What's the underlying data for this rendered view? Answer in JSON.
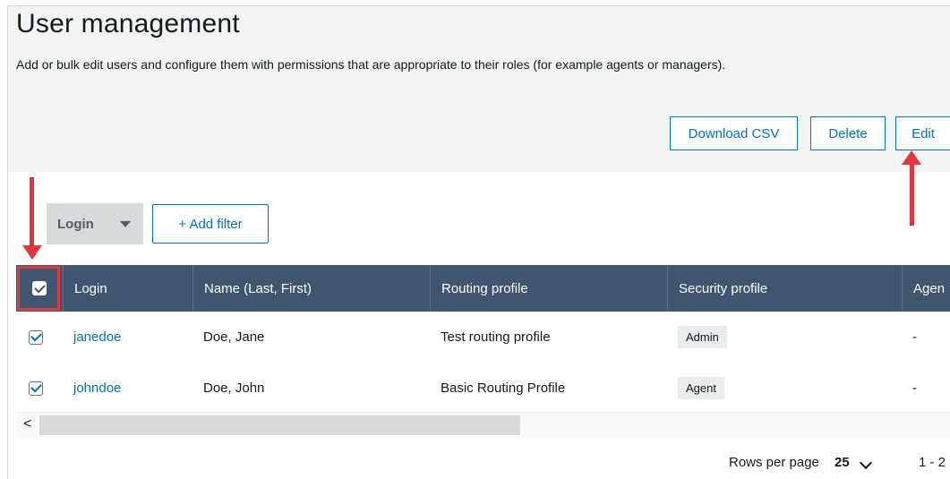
{
  "page": {
    "title": "User management",
    "description": "Add or bulk edit users and configure them with permissions that are appropriate to their roles (for example agents or managers)."
  },
  "toolbar": {
    "download_label": "Download CSV",
    "delete_label": "Delete",
    "edit_label": "Edit"
  },
  "filter": {
    "field_label": "Login",
    "add_filter_label": "+ Add filter"
  },
  "table": {
    "headers": [
      "Login",
      "Name (Last, First)",
      "Routing profile",
      "Security profile",
      "Agen"
    ],
    "header_checkbox_checked": true,
    "rows": [
      {
        "checked": true,
        "login": "janedoe",
        "name": "Doe, Jane",
        "routing_profile": "Test routing profile",
        "security_profile": "Admin",
        "agent": "-"
      },
      {
        "checked": true,
        "login": "johndoe",
        "name": "Doe, John",
        "routing_profile": "Basic Routing Profile",
        "security_profile": "Agent",
        "agent": "-"
      }
    ]
  },
  "scrollbar": {
    "left_glyph": "<"
  },
  "pagination": {
    "rows_per_page_label": "Rows per page",
    "rows_per_page_value": "25",
    "range": "1 - 2"
  },
  "colors": {
    "accent": "#0073bb",
    "table_header": "#3f5570",
    "annotation": "#e0393b"
  }
}
